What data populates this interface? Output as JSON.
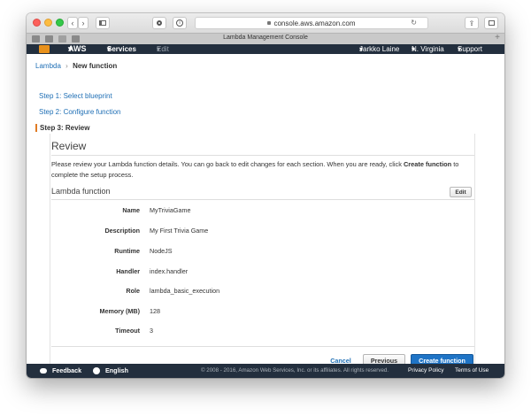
{
  "browser": {
    "url": "console.aws.amazon.com",
    "tab_title": "Lambda Management Console"
  },
  "aws_nav": {
    "logo": "AWS",
    "services": "Services",
    "edit": "Edit",
    "user": "Jarkko Laine",
    "region": "N. Virginia",
    "support": "Support"
  },
  "breadcrumb": {
    "root": "Lambda",
    "separator": "›",
    "current": "New function"
  },
  "steps": [
    {
      "label": "Step 1: Select blueprint"
    },
    {
      "label": "Step 2: Configure function"
    },
    {
      "label": "Step 3: Review"
    }
  ],
  "review": {
    "heading": "Review",
    "description_before": "Please review your Lambda function details. You can go back to edit changes for each section. When you are ready, click ",
    "description_bold": "Create function",
    "description_after": " to complete the setup process.",
    "section_title": "Lambda function",
    "edit_label": "Edit",
    "fields": [
      {
        "label": "Name",
        "value": "MyTriviaGame"
      },
      {
        "label": "Description",
        "value": "My First Trivia Game"
      },
      {
        "label": "Runtime",
        "value": "NodeJS"
      },
      {
        "label": "Handler",
        "value": "index.handler"
      },
      {
        "label": "Role",
        "value": "lambda_basic_execution"
      },
      {
        "label": "Memory (MB)",
        "value": "128"
      },
      {
        "label": "Timeout",
        "value": "3"
      }
    ]
  },
  "actions": {
    "cancel": "Cancel",
    "previous": "Previous",
    "create": "Create function"
  },
  "footer": {
    "feedback": "Feedback",
    "language": "English",
    "copyright": "© 2008 - 2016, Amazon Web Services, Inc. or its affiliates. All rights reserved.",
    "privacy": "Privacy Policy",
    "terms": "Terms of Use"
  },
  "colors": {
    "nav_bg": "#232f3e",
    "link": "#1f6fb5",
    "primary_button": "#1f74c6",
    "step_marker": "#e07b24"
  },
  "icons": [
    "back-icon",
    "forward-icon",
    "sidebar-icon",
    "shield-icon",
    "info-icon",
    "lock-icon",
    "reload-icon",
    "share-icon",
    "tabs-icon",
    "aws-cube-icon",
    "feedback-bubble-icon",
    "globe-icon"
  ]
}
